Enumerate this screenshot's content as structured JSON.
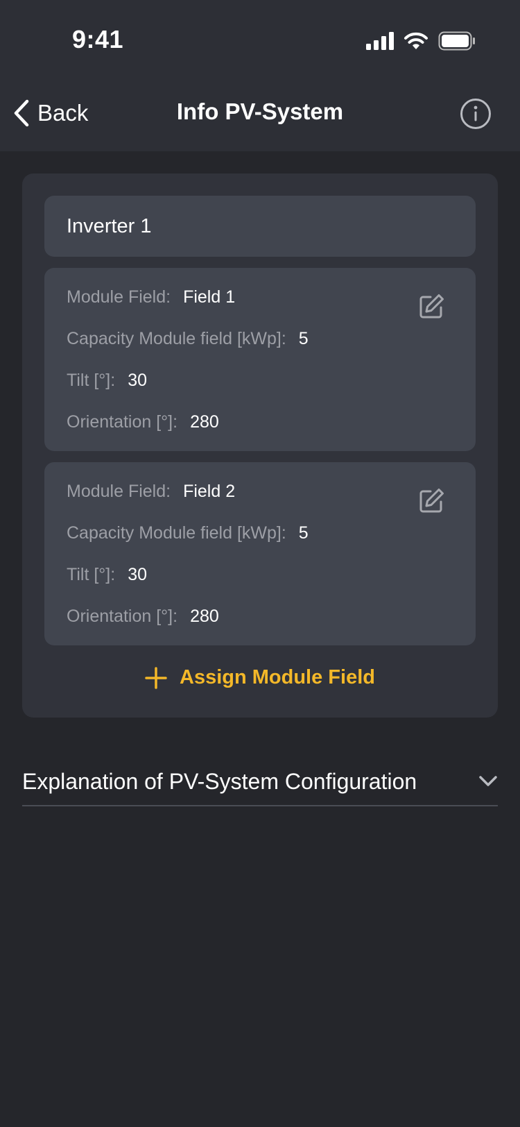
{
  "status_bar": {
    "time": "9:41"
  },
  "nav": {
    "back_label": "Back",
    "title": "Info PV-System"
  },
  "inverter": {
    "name": "Inverter 1"
  },
  "fields": [
    {
      "module_field_label": "Module Field:",
      "module_field_value": "Field 1",
      "capacity_label": "Capacity Module field [kWp]:",
      "capacity_value": "5",
      "tilt_label": "Tilt [°]:",
      "tilt_value": "30",
      "orientation_label": "Orientation [°]:",
      "orientation_value": "280"
    },
    {
      "module_field_label": "Module Field:",
      "module_field_value": "Field 2",
      "capacity_label": "Capacity Module field [kWp]:",
      "capacity_value": "5",
      "tilt_label": "Tilt [°]:",
      "tilt_value": "30",
      "orientation_label": "Orientation [°]:",
      "orientation_value": "280"
    }
  ],
  "assign_button": {
    "label": "Assign Module Field"
  },
  "explanation": {
    "label": "Explanation of PV-System Configuration"
  },
  "colors": {
    "accent": "#f4b829",
    "background": "#25262b",
    "panel": "#31333b",
    "card": "#41454f"
  },
  "icons": {
    "back": "chevron-left-icon",
    "info": "info-circle-icon",
    "edit": "edit-icon",
    "add": "plus-icon",
    "expand": "chevron-down-icon",
    "signal": "cellular-signal-icon",
    "wifi": "wifi-icon",
    "battery": "battery-icon"
  }
}
